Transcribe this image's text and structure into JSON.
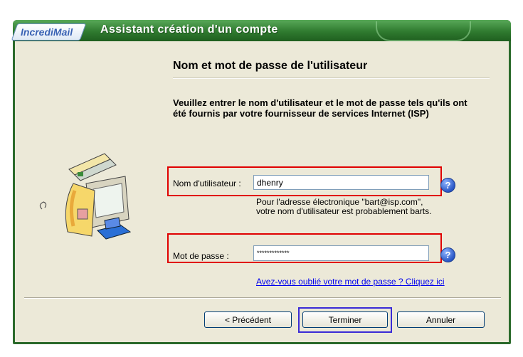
{
  "window": {
    "logo_text": "IncrediMail",
    "title": "Assistant création d'un compte"
  },
  "page": {
    "heading": "Nom et mot de passe de l'utilisateur",
    "instructions": "Veuillez entrer le nom d'utilisateur et le mot de passe tels qu'ils ont été fournis par votre fournisseur de services Internet (ISP)"
  },
  "username": {
    "label": "Nom d'utilisateur :",
    "value": "dhenry",
    "hint_line1": "Pour l'adresse électronique \"bart@isp.com\",",
    "hint_line2": "votre nom d'utilisateur est probablement barts."
  },
  "password": {
    "label": "Mot de passe :",
    "value": "*************",
    "forgot_link": "Avez-vous oublié votre mot de passe ? Cliquez ici"
  },
  "help_symbol": "?",
  "buttons": {
    "back": "< Précédent",
    "finish": "Terminer",
    "cancel": "Annuler"
  },
  "colors": {
    "title_bar": "#2f7a2f",
    "highlight_box": "#e00000",
    "focus_ring": "#3a2bd6",
    "link": "#0000ee"
  },
  "icons": [
    "help-icon",
    "computer-printer-illustration"
  ]
}
